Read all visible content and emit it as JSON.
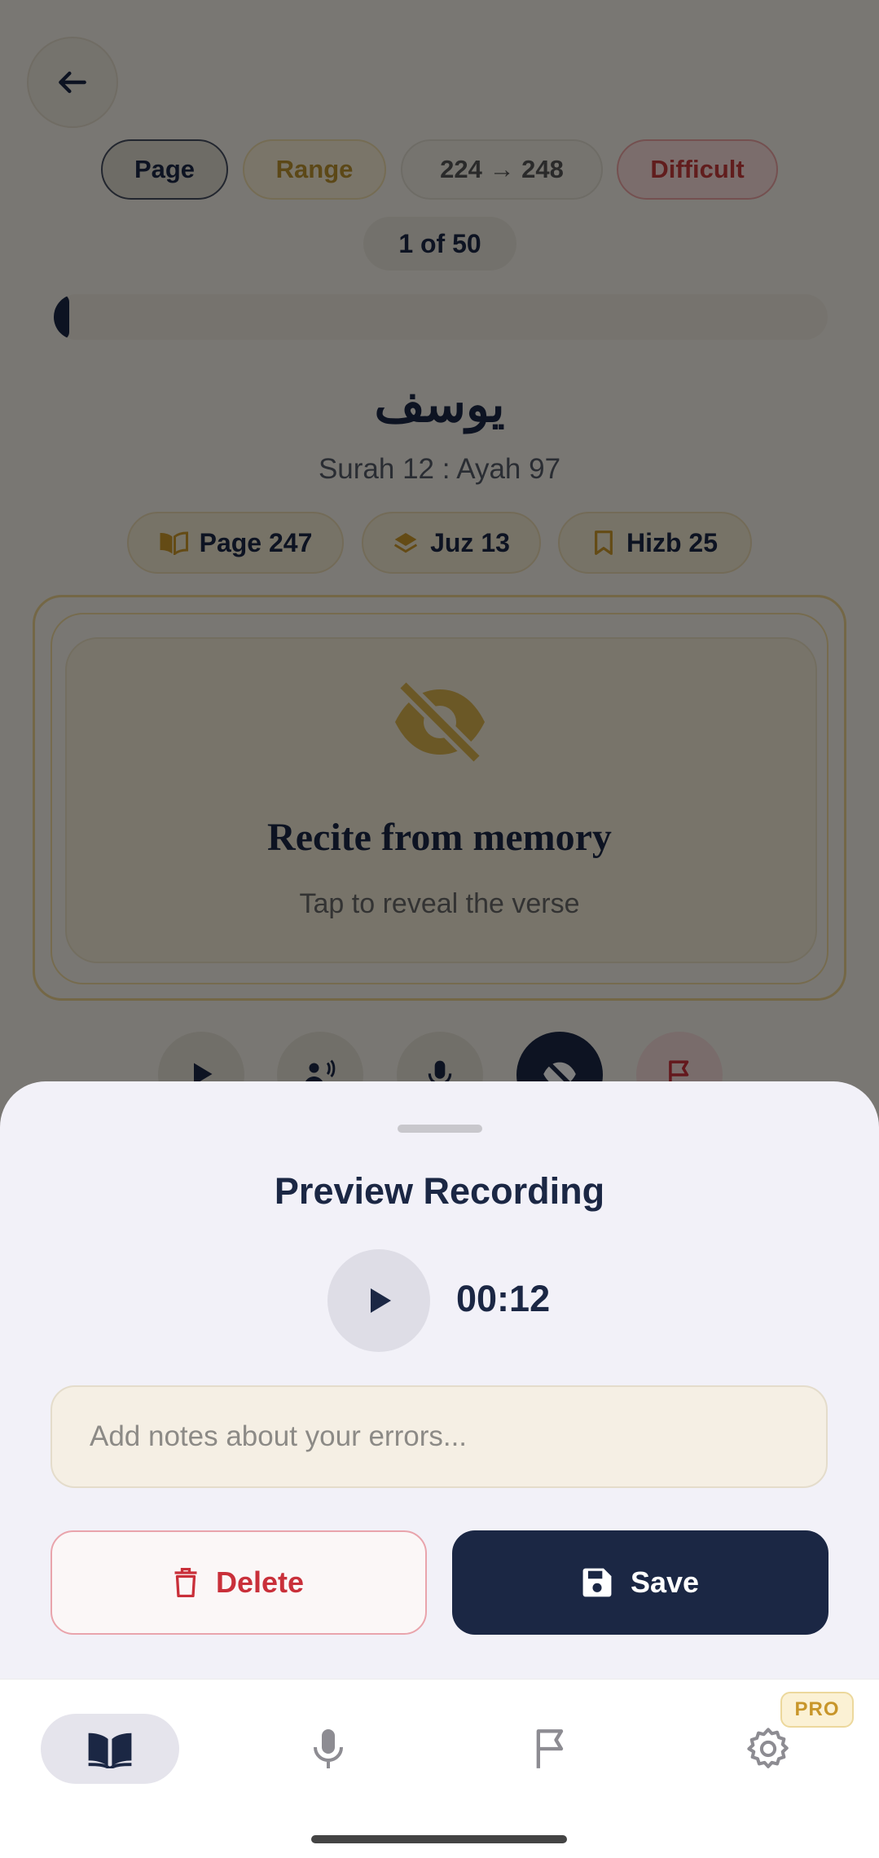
{
  "header": {
    "filters": {
      "page": "Page",
      "range": "Range",
      "pages": "224 → 248",
      "difficulty": "Difficult"
    },
    "counter": "1 of 50",
    "progress_fraction": 0.02
  },
  "surah": {
    "name_ar": "يوسف",
    "reference": "Surah 12 : Ayah 97"
  },
  "info_pills": {
    "page": "Page 247",
    "juz": "Juz 13",
    "hizb": "Hizb 25"
  },
  "memory_card": {
    "title": "Recite from memory",
    "hint": "Tap to reveal the verse"
  },
  "sheet": {
    "title": "Preview Recording",
    "duration": "00:12",
    "notes_placeholder": "Add notes about your errors...",
    "delete_label": "Delete",
    "save_label": "Save"
  },
  "nav": {
    "pro_badge": "PRO"
  },
  "colors": {
    "primary": "#1b2744",
    "accent_gold": "#c8962a",
    "danger": "#c9303a"
  },
  "icons": {
    "back": "arrow-left-icon",
    "page": "open-book-icon",
    "juz": "layers-icon",
    "hizb": "bookmark-icon",
    "hidden": "eye-off-icon",
    "play": "play-icon",
    "listen": "speaker-person-icon",
    "mic": "microphone-icon",
    "flag": "flag-icon",
    "delete": "trash-icon",
    "save": "floppy-disk-icon",
    "settings": "gear-icon"
  }
}
